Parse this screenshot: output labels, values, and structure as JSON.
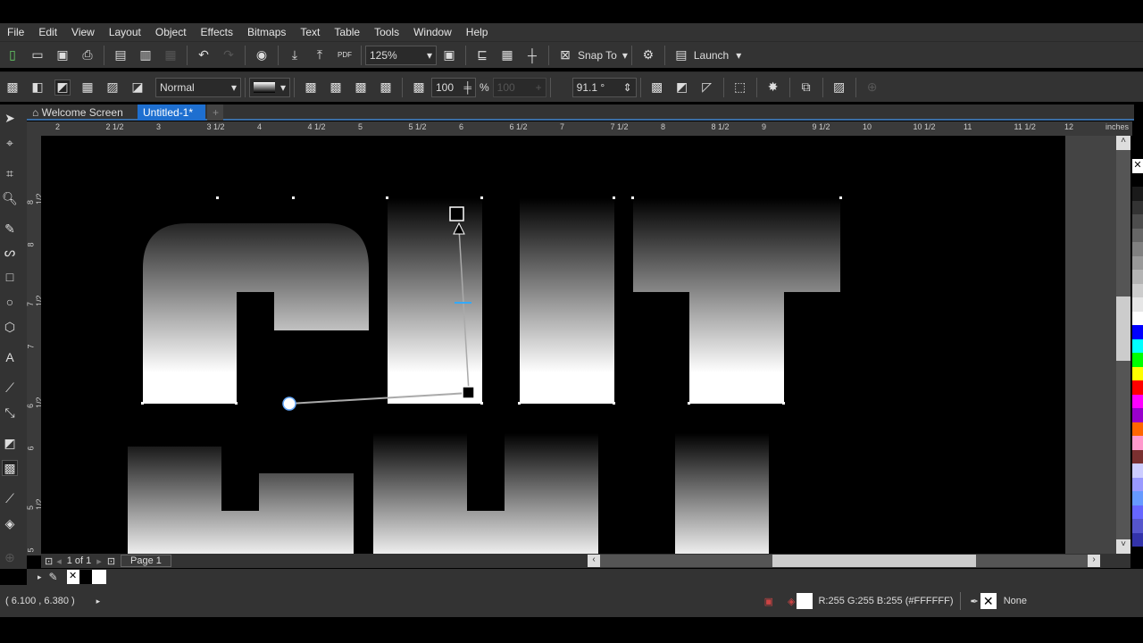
{
  "menu": [
    "File",
    "Edit",
    "View",
    "Layout",
    "Object",
    "Effects",
    "Bitmaps",
    "Text",
    "Table",
    "Tools",
    "Window",
    "Help"
  ],
  "toolbar1": {
    "zoom": "125%",
    "snap": "Snap To",
    "launch": "Launch"
  },
  "toolbar2": {
    "merge_mode": "Normal",
    "opacity": "100",
    "opacity_unit": "%",
    "opacity2": "100",
    "angle": "91.1 °"
  },
  "tabs": [
    {
      "label": "Welcome Screen"
    },
    {
      "label": "Untitled-1*"
    }
  ],
  "ruler": {
    "h_labels": [
      "2",
      "2 1/2",
      "3",
      "3 1/2",
      "4",
      "4 1/2",
      "5",
      "5 1/2",
      "6",
      "6 1/2",
      "7",
      "7 1/2",
      "8",
      "8 1/2",
      "9",
      "9 1/2",
      "10",
      "10 1/2",
      "11",
      "11 1/2",
      "12"
    ],
    "unit": "inches",
    "v_labels": [
      "8 1/2",
      "8",
      "7 1/2",
      "7",
      "6 1/2",
      "6",
      "5 1/2",
      "5"
    ]
  },
  "page_nav": {
    "pages": "1 of 1",
    "page_tab": "Page 1"
  },
  "status": {
    "coords": "( 6.100 , 6.380 )",
    "fill": "R:255 G:255 B:255 (#FFFFFF)",
    "outline": "None"
  },
  "colors": {
    "accent": "#1e6fd0",
    "palette": [
      "#000000",
      "#1a1a1a",
      "#333333",
      "#4d4d4d",
      "#666666",
      "#808080",
      "#999999",
      "#b3b3b3",
      "#cccccc",
      "#e6e6e6",
      "#ffffff",
      "#0000ff",
      "#00ffff",
      "#00ff00",
      "#ffff00",
      "#ff0000",
      "#ff00ff",
      "#9900cc",
      "#ff6600",
      "#ff99cc",
      "#7a3030",
      "#ccccff",
      "#9999ff",
      "#6699ff",
      "#6666ff",
      "#5555cc",
      "#3333aa"
    ]
  }
}
